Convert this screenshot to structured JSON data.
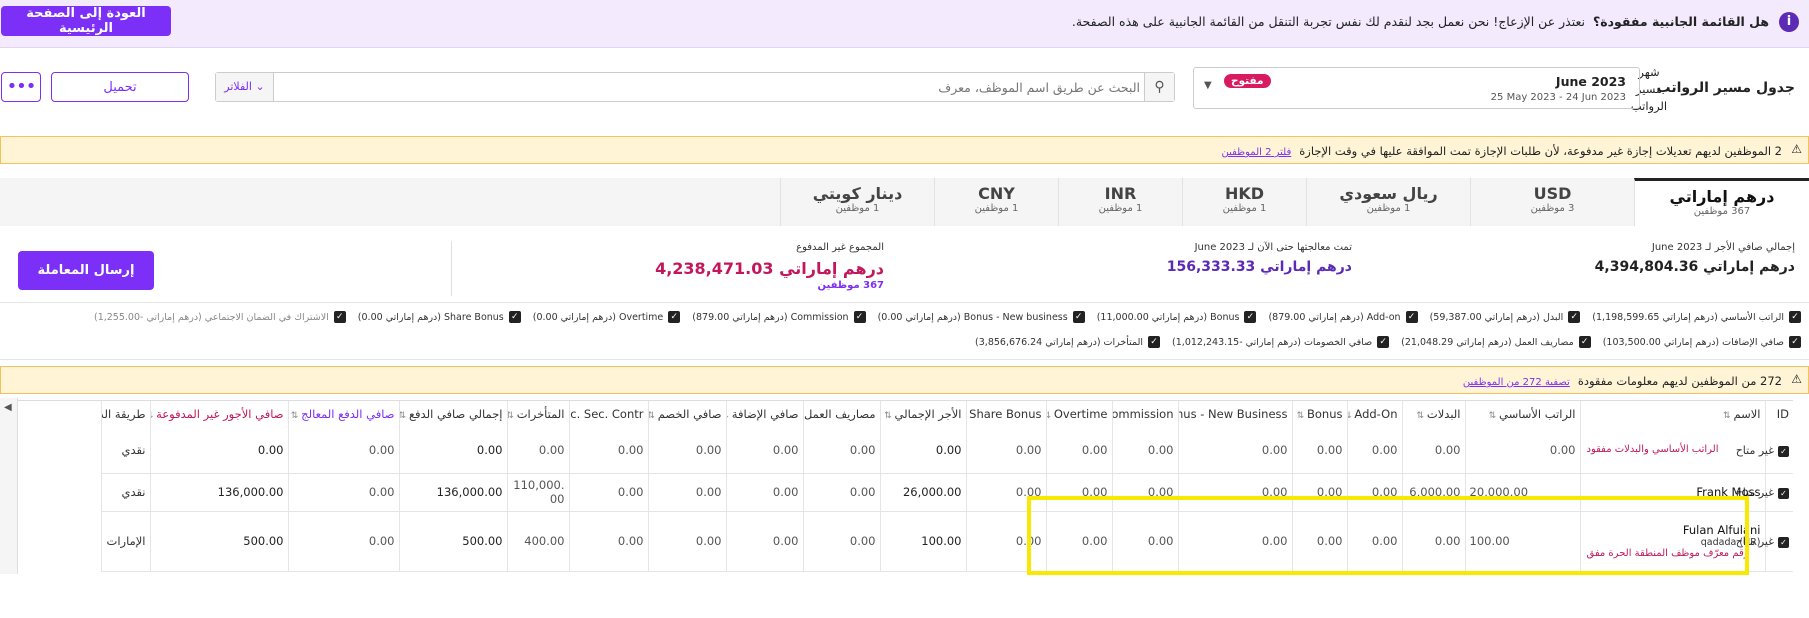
{
  "banner": {
    "title": "هل القائمة الجانبية مفقودة؟",
    "text": "نعتذر عن الإزعاج! نحن نعمل بجد لنقدم لك نفس تجربة التنقل من القائمة الجانبية على هذه الصفحة.",
    "back_label": "العودة إلى الصفحة الرئيسية"
  },
  "header": {
    "title": "جدول مسير الرواتب",
    "month_label": "شهر مسير الرواتب",
    "month_name": "June 2023",
    "month_range": "25 May 2023 - 24 Jun 2023",
    "status": "مفتوح",
    "search_placeholder": "البحث عن طريق اسم الموظف، معرف",
    "filter_label": "الفلاتر",
    "download_label": "تحميل",
    "more_label": "•••"
  },
  "leave_warning": {
    "text": "2 الموظفين لديهم تعديلات إجازة غير مدفوعة، لأن طلبات الإجازة تمت الموافقة عليها في وقت الإجازة",
    "link": "فلتر 2 الموظفين"
  },
  "tabs": [
    {
      "name": "درهم إماراتي",
      "count": "367 موظفين",
      "active": true
    },
    {
      "name": "USD",
      "count": "3 موظفين"
    },
    {
      "name": "ريال سعودي",
      "count": "1 موظفين"
    },
    {
      "name": "HKD",
      "count": "1 موظفين"
    },
    {
      "name": "INR",
      "count": "1 موظفين"
    },
    {
      "name": "CNY",
      "count": "1 موظفين"
    },
    {
      "name": "دينار كويتي",
      "count": "1 موظفين"
    }
  ],
  "summary": {
    "gross_label": "إجمالي صافي الأجر لـ June 2023",
    "gross_value": "درهم إماراتي 4,394,804.36",
    "processed_label": "تمت معالجتها حتى الآن لـ June 2023",
    "processed_value": "درهم إماراتي 156,333.33",
    "unpaid_label": "المجموع غير المدفوع",
    "unpaid_value": "درهم إماراتي 4,238,471.03",
    "unpaid_count": "367 موظفين",
    "send_label": "إرسال المعاملة"
  },
  "checks_row1": [
    "الراتب الأساسي (درهم إماراتي 1,198,599.65)",
    "البدل (درهم إماراتي 59,387.00)",
    "Add-on (درهم إماراتي 879.00)",
    "Bonus (درهم إماراتي 11,000.00)",
    "Bonus - New business (درهم إماراتي 0.00)",
    "Commission (درهم إماراتي 879.00)",
    "Overtime (درهم إماراتي 0.00)",
    "Share Bonus (درهم إماراتي 0.00)",
    "الاشتراك في الضمان الاجتماعي (درهم إماراتي -1,255.00)"
  ],
  "checks_row2": [
    "صافي الإضافات (درهم إماراتي 103,500.00)",
    "مصاريف العمل (درهم إماراتي 21,048.29)",
    "صافي الخصومات (درهم إماراتي -1,012,243.15)",
    "المتأخرات (درهم إماراتي 3,856,676.24)"
  ],
  "missing_warning": {
    "text": "272 من الموظفين لديهم معلومات مفقودة",
    "link": "تصفية 272 من الموظفين"
  },
  "table": {
    "columns": [
      "ID",
      "الاسم",
      "الراتب الأساسي",
      "البدلات",
      "Add-On",
      "Bonus",
      "Bonus - New Business",
      "Commission",
      "Overtime",
      "Share Bonus",
      "الأجر الإجمالي",
      "مصاريف العمل",
      "صافي الإضافة",
      "صافي الخصم",
      "Soc. Sec. Contr.",
      "المتأخرات",
      "إجمالي صافي الدفع",
      "صافي الدفع المعالج",
      "صافي الأجور غير المدفوعة",
      "طريقة الد"
    ],
    "rows": [
      {
        "status": "غير متاح",
        "name": "",
        "note": "الراتب الأساسي والبدلات مفقود",
        "sub": "",
        "cells": [
          "0.00",
          "0.00",
          "0.00",
          "0.00",
          "0.00",
          "0.00",
          "0.00",
          "0.00",
          "0.00",
          "0.00",
          "0.00",
          "0.00",
          "0.00",
          "0.00",
          "0.00",
          "0.00",
          "0.00",
          "نقدي"
        ]
      },
      {
        "status": "غير متاح",
        "name": "Frank Moss",
        "note": "",
        "sub": "",
        "cells": [
          "20,000.00",
          "6,000.00",
          "0.00",
          "0.00",
          "0.00",
          "0.00",
          "0.00",
          "0.00",
          "26,000.00",
          "0.00",
          "0.00",
          "0.00",
          "0.00",
          "110,000.00",
          "136,000.00",
          "0.00",
          "136,000.00",
          "نقدي"
        ]
      },
      {
        "status": "غير متاح",
        "name": "Fulan Alfulani",
        "note": "رقم معرّف موظف المنطقة الحرة مفق",
        "sub": "qadada (HR)",
        "cells": [
          "100.00",
          "0.00",
          "0.00",
          "0.00",
          "0.00",
          "0.00",
          "0.00",
          "0.00",
          "100.00",
          "0.00",
          "0.00",
          "0.00",
          "0.00",
          "400.00",
          "500.00",
          "0.00",
          "500.00",
          "الإمارات ال"
        ]
      }
    ]
  }
}
